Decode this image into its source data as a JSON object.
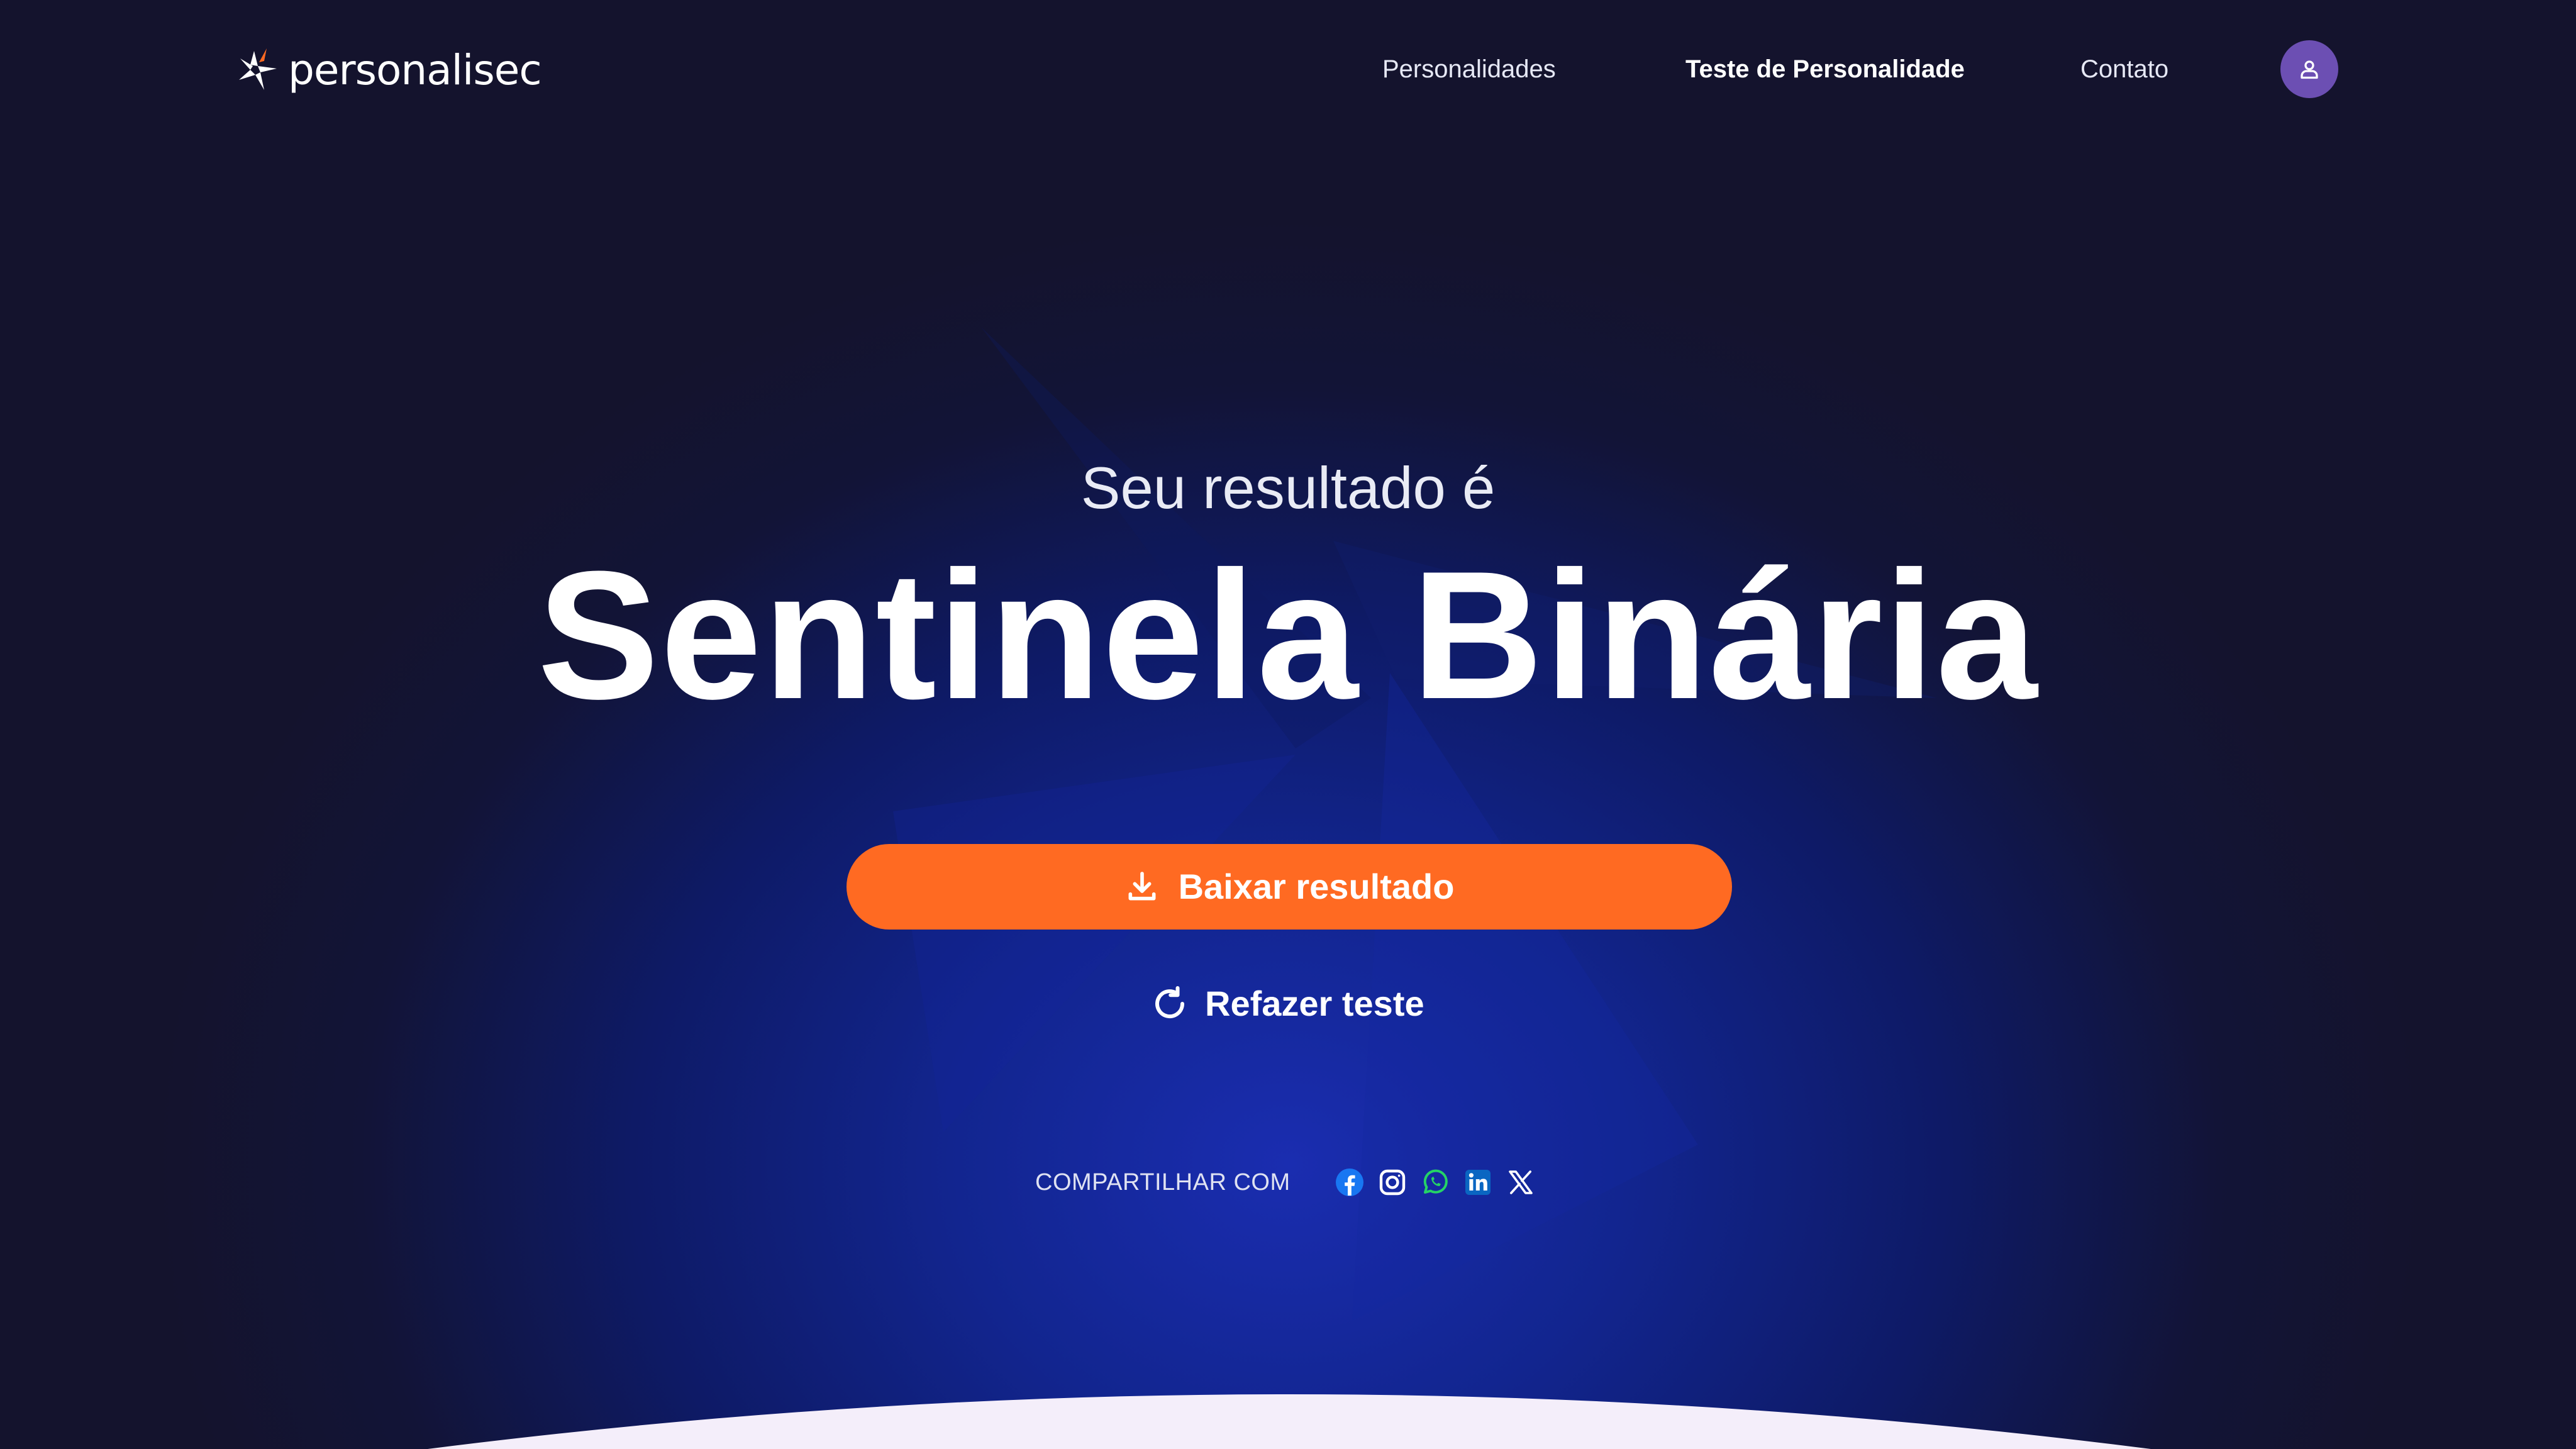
{
  "brand": {
    "name": "personalisec",
    "logo_icon": "star-burst-icon",
    "accent_color": "#ff6a22"
  },
  "nav": {
    "items": [
      {
        "label": "Personalidades",
        "active": false
      },
      {
        "label": "Teste de Personalidade",
        "active": true
      },
      {
        "label": "Contato",
        "active": false
      }
    ],
    "profile_icon": "user-icon",
    "profile_color": "#6c4fb3"
  },
  "hero": {
    "subtitle": "Seu resultado é",
    "result": "Sentinela Binária"
  },
  "actions": {
    "download_label": "Baixar resultado",
    "download_icon": "download-icon",
    "retake_label": "Refazer teste",
    "retake_icon": "refresh-icon"
  },
  "share": {
    "label": "COMPARTILHAR COM",
    "networks": [
      "facebook",
      "instagram",
      "whatsapp",
      "linkedin",
      "x"
    ]
  }
}
